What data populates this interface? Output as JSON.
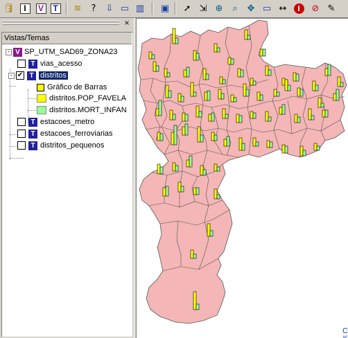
{
  "panel": {
    "tree_header": "Vistas/Temas",
    "close_glyph": "×"
  },
  "tree": {
    "view": {
      "label": "SP_UTM_SAD69_ZONA23",
      "icon": "V",
      "expand": "-"
    },
    "layers": [
      {
        "label": "vias_acesso",
        "checked": false,
        "icon": "T"
      },
      {
        "label": "distritos",
        "checked": true,
        "icon": "T",
        "expand": "-",
        "selected": true
      },
      {
        "label": "estacoes_metro",
        "checked": false,
        "icon": "T"
      },
      {
        "label": "estacoes_ferroviarias",
        "checked": false,
        "icon": "T"
      },
      {
        "label": "distritos_pequenos",
        "checked": false,
        "icon": "T"
      }
    ],
    "legend": {
      "title": "Gráfico de Barras",
      "items": [
        {
          "label": "distritos.POP_FAVELA",
          "color": "#ffff00"
        },
        {
          "label": "distritos.MORT_INFAN",
          "color": "#99ff99"
        }
      ]
    },
    "check_mark": "✔"
  },
  "toolbar": {
    "buttons": [
      {
        "name": "database-icon",
        "glyph": "🛢"
      },
      {
        "name": "info-layer-icon",
        "glyph": "I"
      },
      {
        "name": "view-icon",
        "glyph": "V"
      },
      {
        "name": "theme-icon",
        "glyph": "T"
      },
      {
        "name": "database-stack-icon",
        "glyph": "≋"
      },
      {
        "name": "query-icon",
        "glyph": "?"
      },
      {
        "name": "import-icon",
        "glyph": "⇩"
      },
      {
        "name": "display-icon",
        "glyph": "▭"
      },
      {
        "name": "table-icon",
        "glyph": "▥"
      },
      {
        "name": "window-icon",
        "glyph": "▣"
      },
      {
        "name": "pointer-icon",
        "glyph": "➚"
      },
      {
        "name": "select-icon",
        "glyph": "⇲"
      },
      {
        "name": "zoom-in-icon",
        "glyph": "⊕"
      },
      {
        "name": "zoom-area-icon",
        "glyph": "⌕"
      },
      {
        "name": "pan-icon",
        "glyph": "✥"
      },
      {
        "name": "zoom-extent-icon",
        "glyph": "▭"
      },
      {
        "name": "measure-icon",
        "glyph": "↔"
      },
      {
        "name": "info-icon",
        "glyph": "i"
      },
      {
        "name": "clear-icon",
        "glyph": "⊘"
      },
      {
        "name": "draw-icon",
        "glyph": "✎"
      }
    ]
  },
  "map": {
    "fill_color": "#f4b6b6",
    "stroke_color": "#555555",
    "bar_colors": [
      "#ffff00",
      "#99ff99"
    ],
    "corner_text": [
      "C",
      "K"
    ]
  }
}
